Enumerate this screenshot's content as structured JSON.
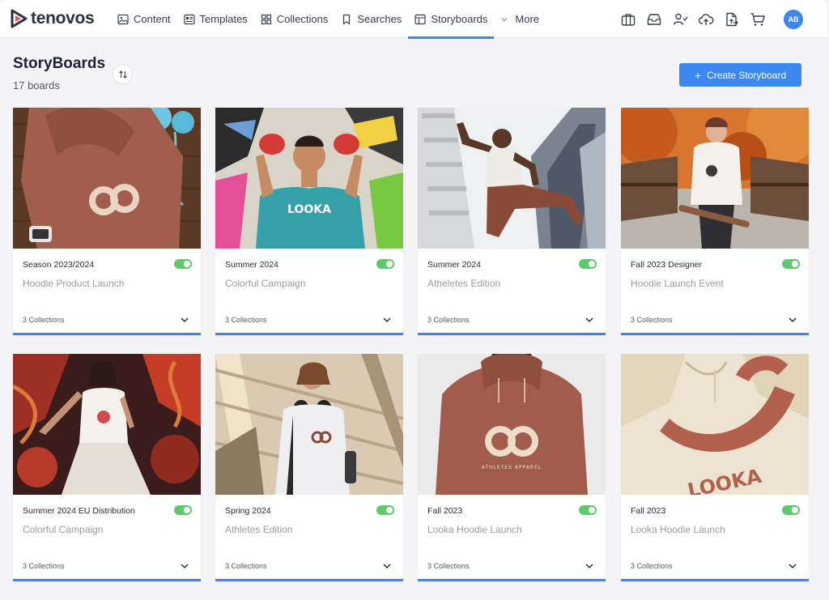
{
  "brand": {
    "name": "tenovos",
    "color": "#3d87f0"
  },
  "nav": {
    "tabs": [
      {
        "label": "Content",
        "icon": "image-icon"
      },
      {
        "label": "Templates",
        "icon": "template-icon"
      },
      {
        "label": "Collections",
        "icon": "grid-icon"
      },
      {
        "label": "Searches",
        "icon": "bookmark-icon"
      },
      {
        "label": "Storyboards",
        "icon": "storyboard-icon",
        "active": true
      },
      {
        "label": "More",
        "icon": "chevron-down-icon"
      }
    ],
    "right_icons": [
      "briefcase-icon",
      "inbox-icon",
      "users-icon",
      "upload-cloud-icon",
      "file-export-icon",
      "cart-icon"
    ],
    "avatar": "AB"
  },
  "header": {
    "title": "StoryBoards",
    "count": "17 boards",
    "create_label": "Create Storyboard"
  },
  "cards": [
    {
      "title": "Season 2023/2024",
      "subtitle": "Hoodie Product Launch",
      "collections": "3 Collections",
      "enabled": true
    },
    {
      "title": "Summer 2024",
      "subtitle": "Colorful Campaign",
      "collections": "3 Collections",
      "enabled": true
    },
    {
      "title": "Summer 2024",
      "subtitle": "Atheletes Edition",
      "collections": "3 Collections",
      "enabled": true
    },
    {
      "title": "Fall 2023 Designer",
      "subtitle": "Hoodie Launch Event",
      "collections": "3 Collections",
      "enabled": true
    },
    {
      "title": "Summer 2024 EU Distribution",
      "subtitle": "Colorful Campaign",
      "collections": "3 Collections",
      "enabled": true
    },
    {
      "title": "Spring 2024",
      "subtitle": "Athletes Edition",
      "collections": "3 Collections",
      "enabled": true
    },
    {
      "title": "Fall 2023",
      "subtitle": "Looka Hoodie Launch",
      "collections": "3 Collections",
      "enabled": true
    },
    {
      "title": "Fall 2023",
      "subtitle": "Looka Hoodie Launch",
      "collections": "3 Collections",
      "enabled": true
    }
  ],
  "thumb_text": {
    "looka": "LOOKA",
    "athletes_apparel": "ATHLETES APPAREL"
  }
}
